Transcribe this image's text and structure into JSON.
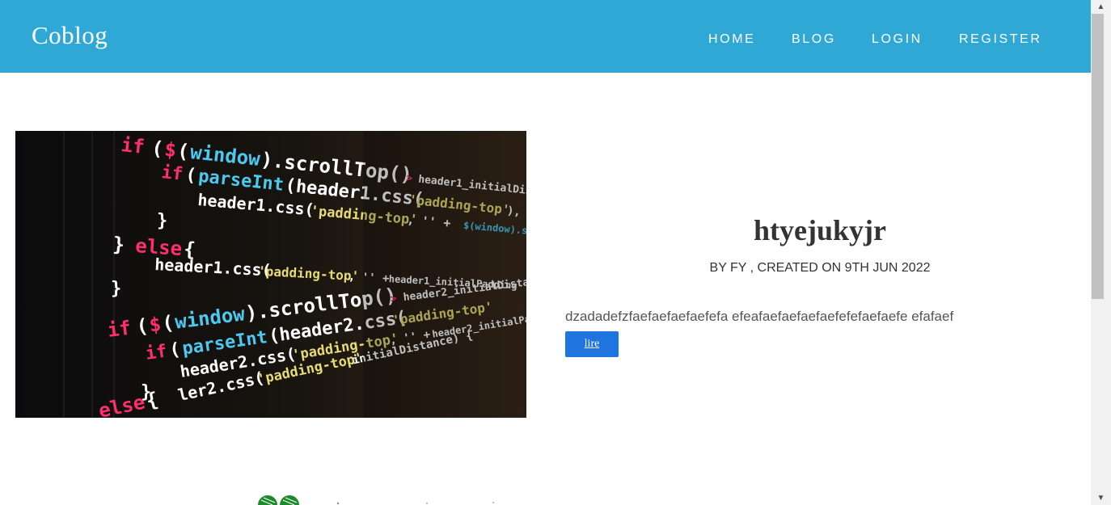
{
  "navbar": {
    "brand": "Coblog",
    "links": [
      {
        "label": "HOME"
      },
      {
        "label": "BLOG"
      },
      {
        "label": "LOGIN"
      },
      {
        "label": "REGISTER"
      }
    ],
    "background": "#2fa8d5"
  },
  "post": {
    "title": "htyejukyjr",
    "meta": "BY FY , CREATED ON 9TH JUN 2022",
    "excerpt": "dzadadefzfaefaefaefaefefa efeafaefaefaefaefefefaefaefe efafaef",
    "read_label": "lire",
    "image_icon": "code-screenshot-image"
  },
  "colors": {
    "accent": "#2fa8d5",
    "button": "#1f74e0",
    "text": "#333333"
  }
}
